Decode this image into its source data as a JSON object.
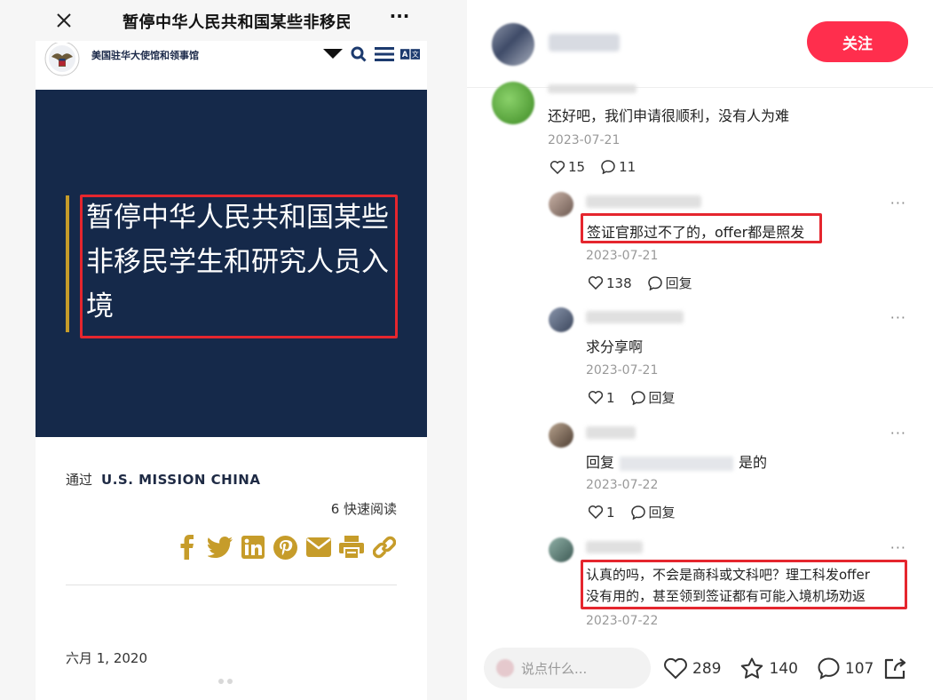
{
  "left": {
    "header_title": "暂停中华人民共和国某些非移民学生和研究人员入境",
    "site_name": "美国驻华大使馆和领事馆",
    "hero_title": "暂停中华人民共和国某些非移民学生和研究人员入境",
    "byline_label": "通过",
    "byline_org": "U.S. MISSION CHINA",
    "read_time": "6 快速阅读",
    "post_date": "六月 1, 2020",
    "share_icons": [
      "facebook-icon",
      "twitter-icon",
      "linkedin-icon",
      "pinterest-icon",
      "mail-icon",
      "print-icon",
      "link-icon"
    ],
    "accent": "#c69c2a",
    "hero_bg": "#15294a"
  },
  "right": {
    "follow_label": "关注",
    "comments": [
      {
        "text": "还好吧，我们申请很顺利，没有人为难",
        "date": "2023-07-21",
        "likes": "15",
        "replies": "11"
      },
      {
        "text": "签证官那过不了的，offer都是照发",
        "date": "2023-07-21",
        "likes": "138",
        "reply_label": "回复"
      },
      {
        "text": "求分享啊",
        "date": "2023-07-21",
        "likes": "1",
        "reply_label": "回复"
      },
      {
        "text_prefix": "回复",
        "text_suffix": "是的",
        "date": "2023-07-22",
        "likes": "1",
        "reply_label": "回复"
      },
      {
        "text_line1": "认真的吗，不会是商科或文科吧？理工科发offer",
        "text_line2": "没有用的，甚至领到签证都有可能入境机场劝返",
        "date": "2023-07-22"
      }
    ],
    "input_placeholder": "说点什么...",
    "stats": {
      "likes": "289",
      "favorites": "140",
      "comments": "107"
    },
    "accent": "#ff2e4d"
  }
}
